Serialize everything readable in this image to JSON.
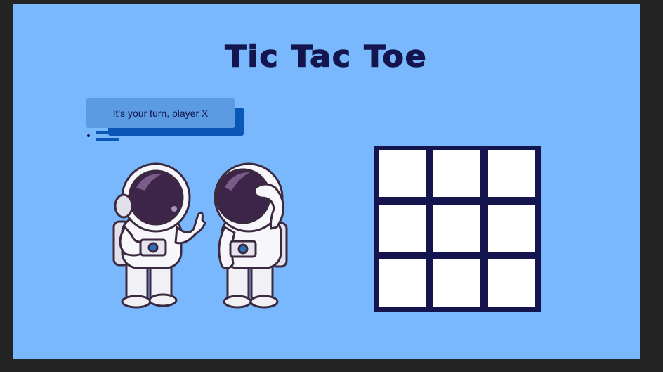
{
  "title": "Tic Tac Toe",
  "status_message": "It's your turn, player X",
  "board": {
    "cells": [
      "",
      "",
      "",
      "",
      "",
      "",
      "",
      "",
      ""
    ]
  },
  "colors": {
    "background": "#7ab8fd",
    "accent_dark": "#14154f",
    "bubble": "#5b9be2",
    "bubble_shadow": "#0b57b7",
    "cell": "#ffffff"
  },
  "illustration": {
    "left_figure": "astronaut-pointing",
    "right_figure": "astronaut-thinking"
  }
}
